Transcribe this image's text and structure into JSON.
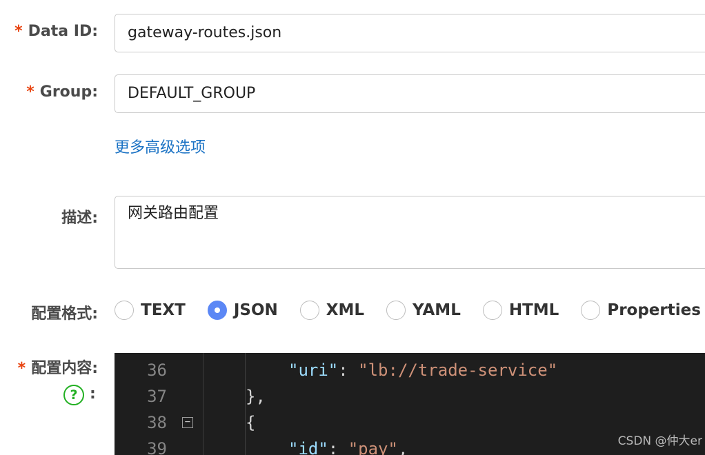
{
  "form": {
    "data_id": {
      "label": "Data ID:",
      "value": "gateway-routes.json"
    },
    "group": {
      "label": "Group:",
      "value": "DEFAULT_GROUP"
    },
    "more_options_link": "更多高级选项",
    "description": {
      "label": "描述:",
      "value": "网关路由配置"
    },
    "format": {
      "label": "配置格式:",
      "options": [
        "TEXT",
        "JSON",
        "XML",
        "YAML",
        "HTML",
        "Properties"
      ],
      "selected": "JSON"
    },
    "content": {
      "label": "配置内容:",
      "help_icon": "?",
      "help_colon": ":"
    },
    "required_mark": "*"
  },
  "editor": {
    "lines": [
      {
        "num": "36",
        "key": "\"uri\"",
        "sep": ": ",
        "value": "\"lb://trade-service\"",
        "tail": ""
      },
      {
        "num": "37",
        "text": "},"
      },
      {
        "num": "38",
        "text": "{",
        "foldable": true
      },
      {
        "num": "39",
        "key": "\"id\"",
        "sep": ": ",
        "value": "\"pay\"",
        "tail": ","
      }
    ]
  },
  "watermark": "CSDN @仲大er",
  "colors": {
    "accent_blue": "#5b87f5",
    "link": "#1a72c4",
    "required": "#e8430f",
    "help_green": "#22b022"
  }
}
